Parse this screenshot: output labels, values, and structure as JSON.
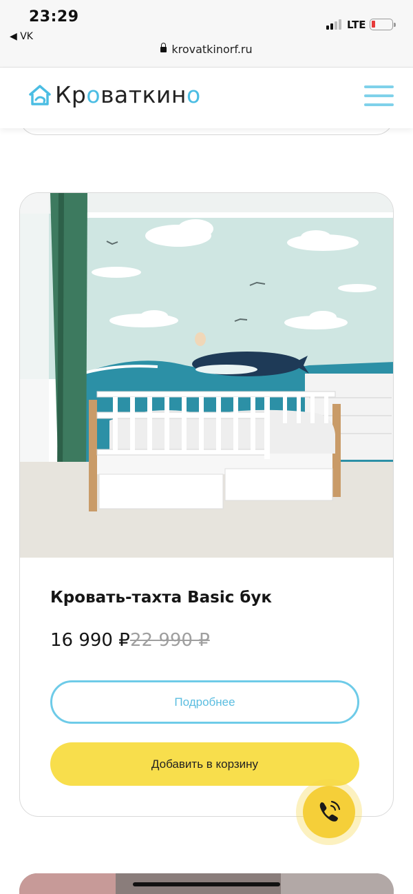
{
  "status_bar": {
    "time": "23:29",
    "back_app": "◀ VK",
    "network": "LTE",
    "battery_level": 0.15,
    "url": "krovatkinorf.ru"
  },
  "header": {
    "logo_text_pre": "Кр",
    "logo_text_o": "о",
    "logo_text_mid": "ваткин",
    "logo_text_o2": "о",
    "accent_color": "#4bbde3",
    "menu_icon": "hamburger-icon"
  },
  "product": {
    "title": "Кровать-тахта Basic бук",
    "price": "16 990 ₽",
    "old_price": "22 990 ₽",
    "details_label": "Подробнее",
    "cart_label": "Добавить в корзину",
    "cart_color": "#f8de4c",
    "details_color": "#6ecbe8"
  },
  "call_button": {
    "icon": "phone-icon"
  }
}
